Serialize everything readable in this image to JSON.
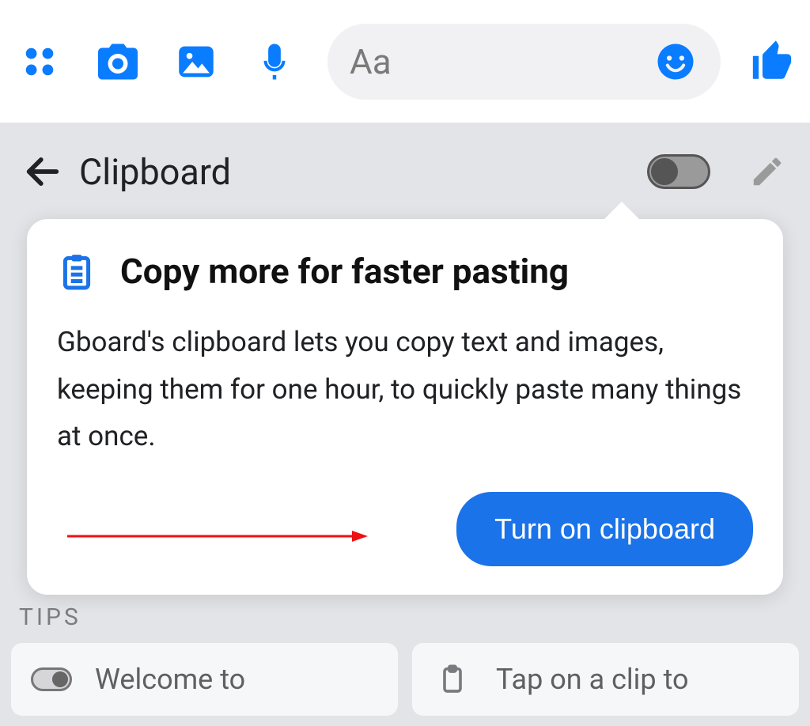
{
  "chatBar": {
    "placeholder": "Aa"
  },
  "clipboard": {
    "title": "Clipboard",
    "popover": {
      "heading": "Copy more for faster pasting",
      "body": "Gboard's clipboard lets you copy text and images, keeping them for one hour, to quickly paste many things at once.",
      "cta": "Turn on clipboard"
    },
    "tipsLabel": "TIPS",
    "tips": [
      {
        "text": "Welcome to"
      },
      {
        "text": "Tap on a clip to"
      }
    ]
  }
}
